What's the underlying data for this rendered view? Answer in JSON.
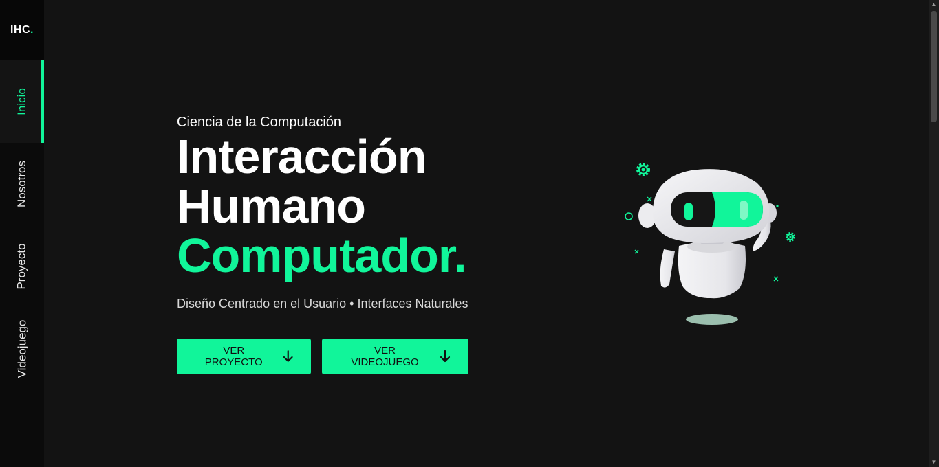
{
  "brand": {
    "logo_text": "IHC",
    "logo_dot": ".",
    "accent_color": "#11f59a"
  },
  "sidebar": {
    "items": [
      {
        "label": "Inicio",
        "active": true
      },
      {
        "label": "Nosotros",
        "active": false
      },
      {
        "label": "Proyecto",
        "active": false
      },
      {
        "label": "Videojuego",
        "active": false
      }
    ]
  },
  "hero": {
    "kicker": "Ciencia de la Computación",
    "headline_line1": "Interacción",
    "headline_line2": "Humano",
    "headline_accent": "Computador.",
    "subtitle": "Diseño Centrado en el Usuario • Interfaces Naturales",
    "buttons": [
      {
        "label": "VER PROYECTO",
        "icon": "arrow-down-icon"
      },
      {
        "label": "VER VIDEOJUEGO",
        "icon": "arrow-down-icon"
      }
    ]
  },
  "illustration": {
    "icon": "robot-icon"
  }
}
